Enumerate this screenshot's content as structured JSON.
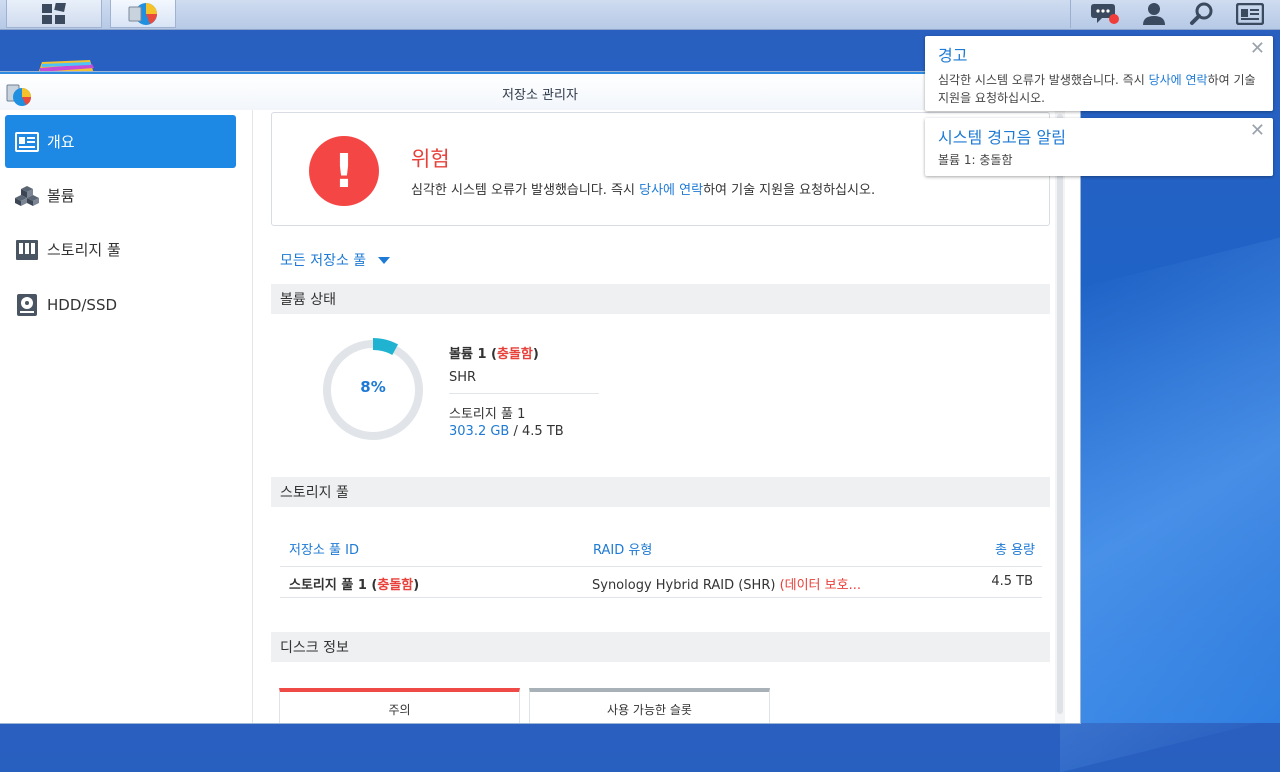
{
  "window": {
    "title": "저장소 관리자"
  },
  "sidebar": {
    "items": [
      {
        "label": "개요",
        "icon": "overview-card-icon",
        "active": true
      },
      {
        "label": "볼륨",
        "icon": "cubes-icon",
        "active": false
      },
      {
        "label": "스토리지 풀",
        "icon": "storage-pool-icon",
        "active": false
      },
      {
        "label": "HDD/SSD",
        "icon": "hdd-icon",
        "active": false
      }
    ]
  },
  "alert": {
    "title": "위험",
    "text_before": "심각한 시스템 오류가 발생했습니다. 즉시 ",
    "link": "당사에 연락",
    "text_after": "하여 기술 지원을 요청하십시오."
  },
  "pool_selector": {
    "label": "모든 저장소 풀"
  },
  "sections": {
    "volume_status": "볼륨 상태",
    "storage_pool": "스토리지 풀",
    "disk_info": "디스크 정보"
  },
  "volume": {
    "usage_percent": 8,
    "usage_label": "8%",
    "name": "볼륨 1",
    "status": "충돌함",
    "type": "SHR",
    "pool": "스토리지 풀 1",
    "used": "303.2 GB",
    "separator": "/",
    "total": "4.5 TB"
  },
  "pool_table": {
    "headers": [
      "저장소 풀 ID",
      "RAID 유형",
      "총 용량"
    ],
    "rows": [
      {
        "id": "스토리지 풀 1",
        "status": "충돌함",
        "raid": "Synology Hybrid RAID (SHR)",
        "raid_status": "(데이터 보호...",
        "capacity": "4.5 TB"
      }
    ]
  },
  "disk_tabs": [
    {
      "label": "주의",
      "color": "#f04a47"
    },
    {
      "label": "사용 가능한 슬롯",
      "color": "#a8b0b8"
    }
  ],
  "notifications": [
    {
      "title": "경고",
      "body_before": "심각한 시스템 오류가 발생했습니다. 즉시 ",
      "link": "당사에 연락",
      "body_after": "하여 기술 지원을 요청하십시오."
    },
    {
      "title": "시스템 경고음 알림",
      "body": "볼륨 1: 충돌함"
    }
  ],
  "colors": {
    "accent": "#1e88e5",
    "danger": "#f44745",
    "link": "#1e7ad4",
    "donut_fill": "#1fb3d1"
  }
}
